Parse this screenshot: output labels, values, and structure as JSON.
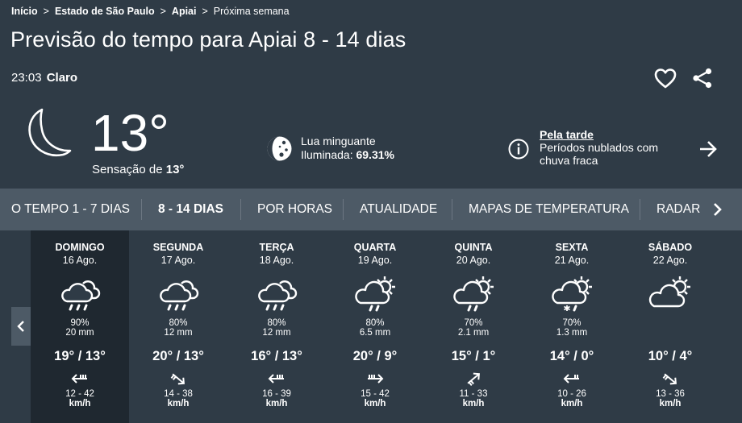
{
  "breadcrumb": [
    {
      "label": "Início"
    },
    {
      "label": "Estado de São Paulo"
    },
    {
      "label": "Apiai"
    },
    {
      "label": "Próxima semana"
    }
  ],
  "breadcrumb_separator": ">",
  "title": "Previsão do tempo para Apiai 8 - 14 dias",
  "current": {
    "time": "23:03",
    "condition": "Claro",
    "temperature": "13°",
    "feels_label": "Sensação de",
    "feels_value": "13°",
    "icon": "crescent-moon-icon"
  },
  "moon": {
    "phase": "Lua minguante",
    "illuminated_label": "Iluminada:",
    "illuminated_value": "69.31%",
    "icon": "moon-phase-icon"
  },
  "afternoon": {
    "heading": "Pela tarde",
    "text": "Períodos nublados com chuva fraca"
  },
  "actions": {
    "favorite_icon": "heart-icon",
    "share_icon": "share-icon",
    "next_icon": "arrow-right-icon"
  },
  "tabs": [
    {
      "label": "O TEMPO 1 - 7 DIAS",
      "active": false
    },
    {
      "label": "8 - 14 DIAS",
      "active": true
    },
    {
      "label": "POR HORAS",
      "active": false
    },
    {
      "label": "ATUALIDADE",
      "active": false
    },
    {
      "label": "MAPAS DE TEMPERATURA",
      "active": false
    },
    {
      "label": "RADAR",
      "active": false
    }
  ],
  "days": [
    {
      "name": "DOMINGO",
      "date": "16 Ago.",
      "icon": "cloud-rain-icon",
      "precip_prob": "90%",
      "precip_amount": "20 mm",
      "temps": "19° / 13°",
      "wind_icon": "wind-arrow-icon",
      "wind": "12 - 42",
      "wind_unit": "km/h",
      "active": true
    },
    {
      "name": "SEGUNDA",
      "date": "17 Ago.",
      "icon": "cloud-rain-icon",
      "precip_prob": "80%",
      "precip_amount": "12 mm",
      "temps": "20° / 13°",
      "wind_icon": "wind-arrow-icon",
      "wind": "14 - 38",
      "wind_unit": "km/h",
      "active": false
    },
    {
      "name": "TERÇA",
      "date": "18 Ago.",
      "icon": "cloud-rain-icon",
      "precip_prob": "80%",
      "precip_amount": "12 mm",
      "temps": "16° / 13°",
      "wind_icon": "wind-arrow-icon",
      "wind": "16 - 39",
      "wind_unit": "km/h",
      "active": false
    },
    {
      "name": "QUARTA",
      "date": "19 Ago.",
      "icon": "sun-cloud-rain-icon",
      "precip_prob": "80%",
      "precip_amount": "6.5 mm",
      "temps": "20° /  9°",
      "wind_icon": "wind-arrow-icon",
      "wind": "15 - 42",
      "wind_unit": "km/h",
      "active": false
    },
    {
      "name": "QUINTA",
      "date": "20 Ago.",
      "icon": "sun-cloud-rain-icon",
      "precip_prob": "70%",
      "precip_amount": "2.1 mm",
      "temps": "15° /  1°",
      "wind_icon": "wind-arrow-icon",
      "wind": "11 - 33",
      "wind_unit": "km/h",
      "active": false
    },
    {
      "name": "SEXTA",
      "date": "21 Ago.",
      "icon": "sun-cloud-sleet-icon",
      "precip_prob": "70%",
      "precip_amount": "1.3 mm",
      "temps": "14° /  0°",
      "wind_icon": "wind-arrow-icon",
      "wind": "10 - 26",
      "wind_unit": "km/h",
      "active": false
    },
    {
      "name": "SÁBADO",
      "date": "22 Ago.",
      "icon": "sun-cloud-icon",
      "precip_prob": "",
      "precip_amount": "",
      "temps": "10° /  4°",
      "wind_icon": "wind-arrow-icon",
      "wind": "13 - 36",
      "wind_unit": "km/h",
      "active": false
    }
  ]
}
